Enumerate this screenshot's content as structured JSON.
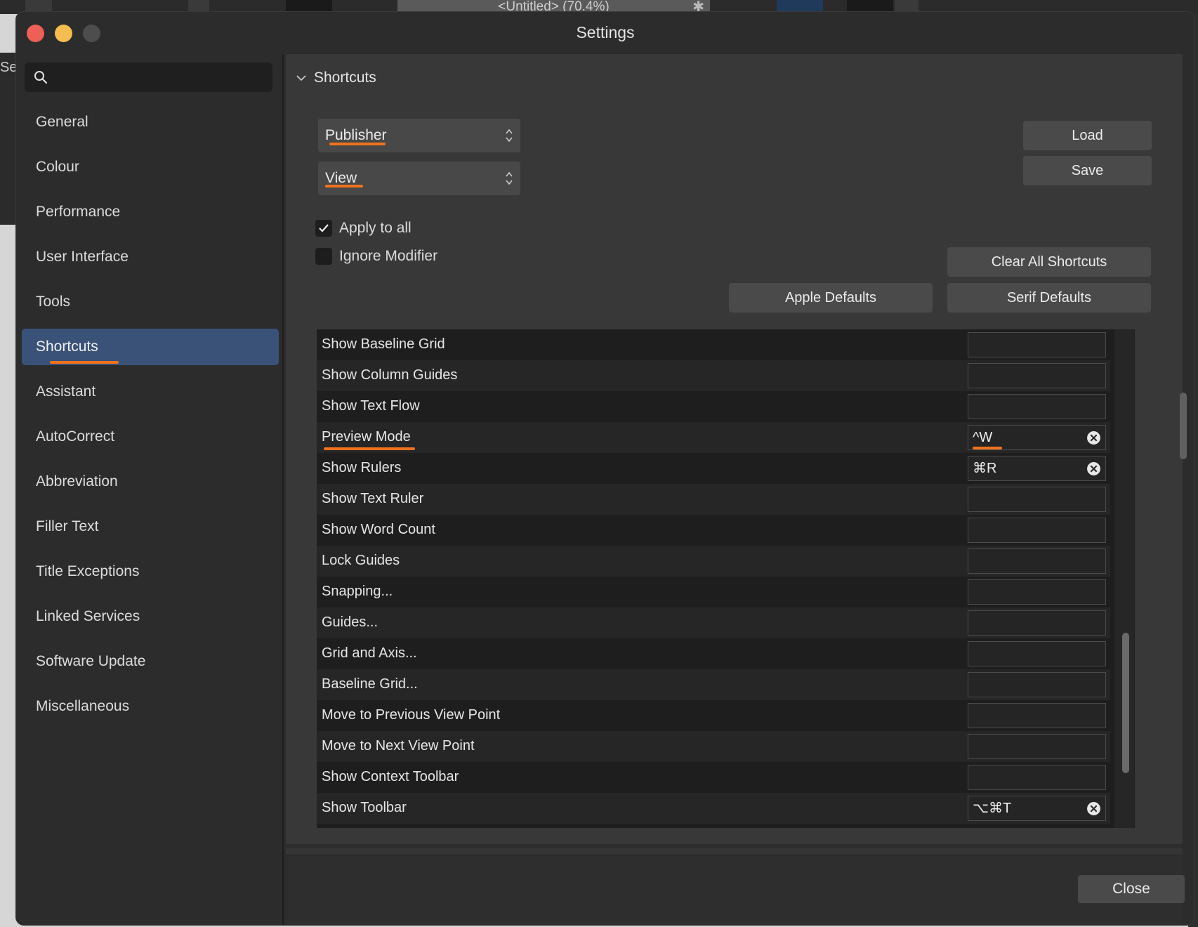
{
  "app": {
    "document_tab": "<Untitled> (70.4%)",
    "side_fragment": "Se"
  },
  "window": {
    "title": "Settings"
  },
  "search": {
    "placeholder": ""
  },
  "sidebar": {
    "items": [
      {
        "label": "General"
      },
      {
        "label": "Colour"
      },
      {
        "label": "Performance"
      },
      {
        "label": "User Interface"
      },
      {
        "label": "Tools"
      },
      {
        "label": "Shortcuts"
      },
      {
        "label": "Assistant"
      },
      {
        "label": "AutoCorrect"
      },
      {
        "label": "Abbreviation"
      },
      {
        "label": "Filler Text"
      },
      {
        "label": "Title Exceptions"
      },
      {
        "label": "Linked Services"
      },
      {
        "label": "Software Update"
      },
      {
        "label": "Miscellaneous"
      }
    ],
    "active_index": 5
  },
  "shortcuts": {
    "section_title": "Shortcuts",
    "app_select": "Publisher",
    "category_select": "View",
    "apply_to_all_label": "Apply to all",
    "apply_to_all_checked": true,
    "ignore_modifier_label": "Ignore Modifier",
    "ignore_modifier_checked": false,
    "load_label": "Load",
    "save_label": "Save",
    "clear_all_label": "Clear All Shortcuts",
    "apple_defaults_label": "Apple Defaults",
    "serif_defaults_label": "Serif Defaults",
    "rows": [
      {
        "name": "Show Baseline Grid",
        "key": ""
      },
      {
        "name": "Show Column Guides",
        "key": ""
      },
      {
        "name": "Show Text Flow",
        "key": ""
      },
      {
        "name": "Preview Mode",
        "key": "^W"
      },
      {
        "name": "Show Rulers",
        "key": "⌘R"
      },
      {
        "name": "Show Text Ruler",
        "key": ""
      },
      {
        "name": "Show Word Count",
        "key": ""
      },
      {
        "name": "Lock Guides",
        "key": ""
      },
      {
        "name": "Snapping...",
        "key": ""
      },
      {
        "name": "Guides...",
        "key": ""
      },
      {
        "name": "Grid and Axis...",
        "key": ""
      },
      {
        "name": "Baseline Grid...",
        "key": ""
      },
      {
        "name": "Move to Previous View Point",
        "key": ""
      },
      {
        "name": "Move to Next View Point",
        "key": ""
      },
      {
        "name": "Show Context Toolbar",
        "key": ""
      },
      {
        "name": "Show Toolbar",
        "key": "⌥⌘T"
      }
    ]
  },
  "footer": {
    "close_label": "Close"
  },
  "colors": {
    "accent_selection": "#3a5278",
    "annotation": "#f0721e",
    "close_red": "#ed5f57",
    "minimize_yellow": "#f4bd4f"
  }
}
